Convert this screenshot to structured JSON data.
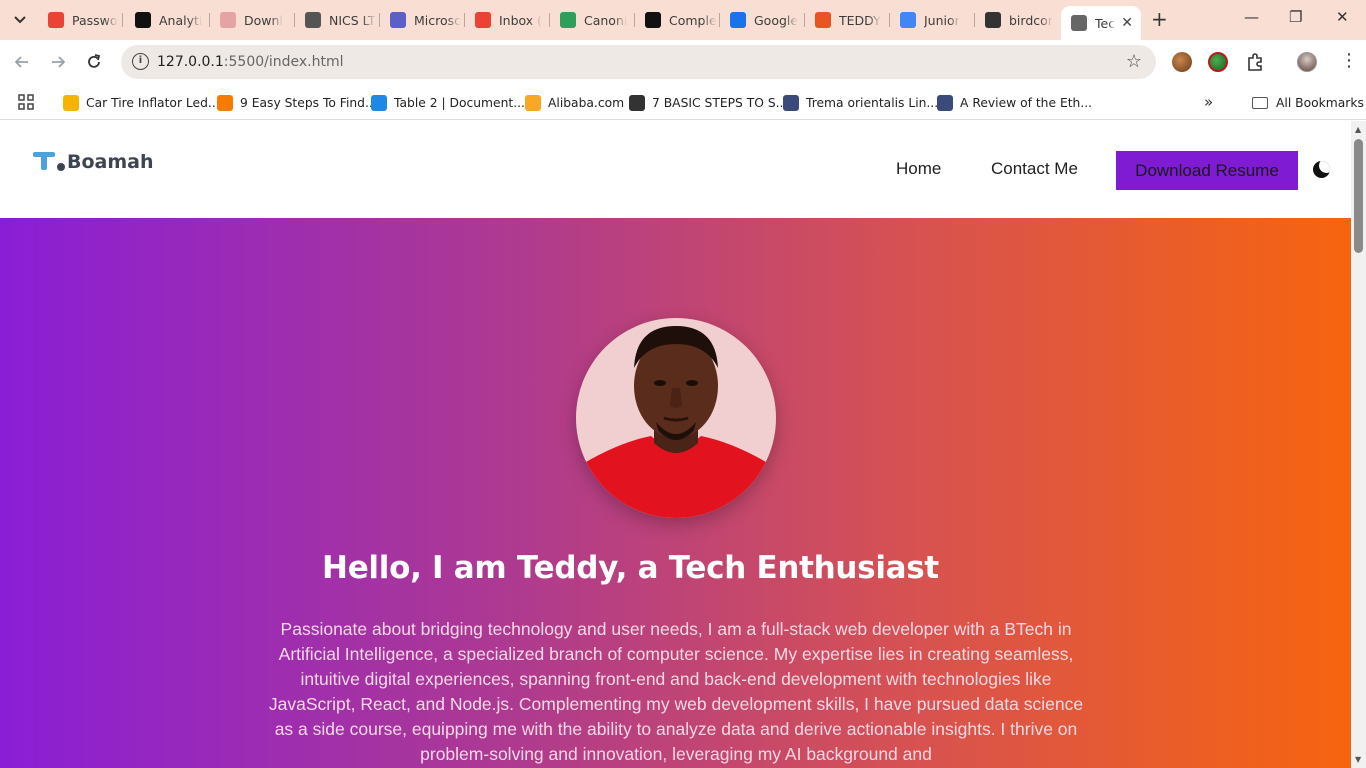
{
  "browser": {
    "tabs": [
      {
        "label": "Passwo",
        "icon": "gmail-icon",
        "color": "#ea4335"
      },
      {
        "label": "Analyti",
        "icon": "x-icon",
        "color": "#111111"
      },
      {
        "label": "Downl",
        "icon": "document-icon",
        "color": "#e6a3a3"
      },
      {
        "label": "NICS LT",
        "icon": "nics-icon",
        "color": "#555555"
      },
      {
        "label": "Microsc",
        "icon": "teams-icon",
        "color": "#5b5fc7"
      },
      {
        "label": "Inbox (",
        "icon": "gmail-icon",
        "color": "#ea4335"
      },
      {
        "label": "Canoni",
        "icon": "canonical-icon",
        "color": "#2e9e5b"
      },
      {
        "label": "Comple",
        "icon": "medium-icon",
        "color": "#111111"
      },
      {
        "label": "Google",
        "icon": "google-account-icon",
        "color": "#1a73e8"
      },
      {
        "label": "TEDDY",
        "icon": "ubuntu-icon",
        "color": "#e95420"
      },
      {
        "label": "Junior",
        "icon": "google-docs-icon",
        "color": "#4285f4"
      },
      {
        "label": "birdcor",
        "icon": "github-icon",
        "color": "#333333"
      },
      {
        "label": "Tec",
        "icon": "globe-icon",
        "color": "#666666"
      }
    ],
    "url_host": "127.0.0.1",
    "url_path": ":5500/index.html",
    "bookmarks": [
      {
        "label": "Car Tire Inflator Led...",
        "color": "#f4b400"
      },
      {
        "label": "9 Easy Steps To Find...",
        "color": "#f57c00"
      },
      {
        "label": "Table 2 | Document...",
        "color": "#1e88e5"
      },
      {
        "label": "Alibaba.com",
        "color": "#f9a825"
      },
      {
        "label": "7 BASIC STEPS TO S...",
        "color": "#333333"
      },
      {
        "label": "Trema orientalis Lin...",
        "color": "#3a4a7a"
      },
      {
        "label": "A Review of the Eth...",
        "color": "#3a4a7a"
      }
    ],
    "all_bookmarks": "All Bookmarks",
    "more_glyph": "»",
    "new_tab_glyph": "+",
    "minimize_glyph": "—",
    "restore_glyph": "❐",
    "close_glyph": "✕"
  },
  "site": {
    "logo_text": "Boamah",
    "nav": {
      "home": "Home",
      "contact": "Contact Me",
      "resume": "Download Resume"
    },
    "hero": {
      "title": "Hello, I am Teddy, a Tech Enthusiast",
      "text": "Passionate about bridging technology and user needs, I am a full-stack web developer with a BTech in Artificial Intelligence, a specialized branch of computer science. My expertise lies in creating seamless, intuitive digital experiences, spanning front-end and back-end development with technologies like JavaScript, React, and Node.js. Complementing my web development skills, I have pursued data science as a side course, equipping me with the ability to analyze data and derive actionable insights. I thrive on problem-solving and innovation, leveraging my AI background and"
    },
    "colors": {
      "accent": "#7e1bd3",
      "gradient_start": "#8a1ed6",
      "gradient_end": "#f7640f",
      "logo_blue": "#4aa3df"
    }
  }
}
